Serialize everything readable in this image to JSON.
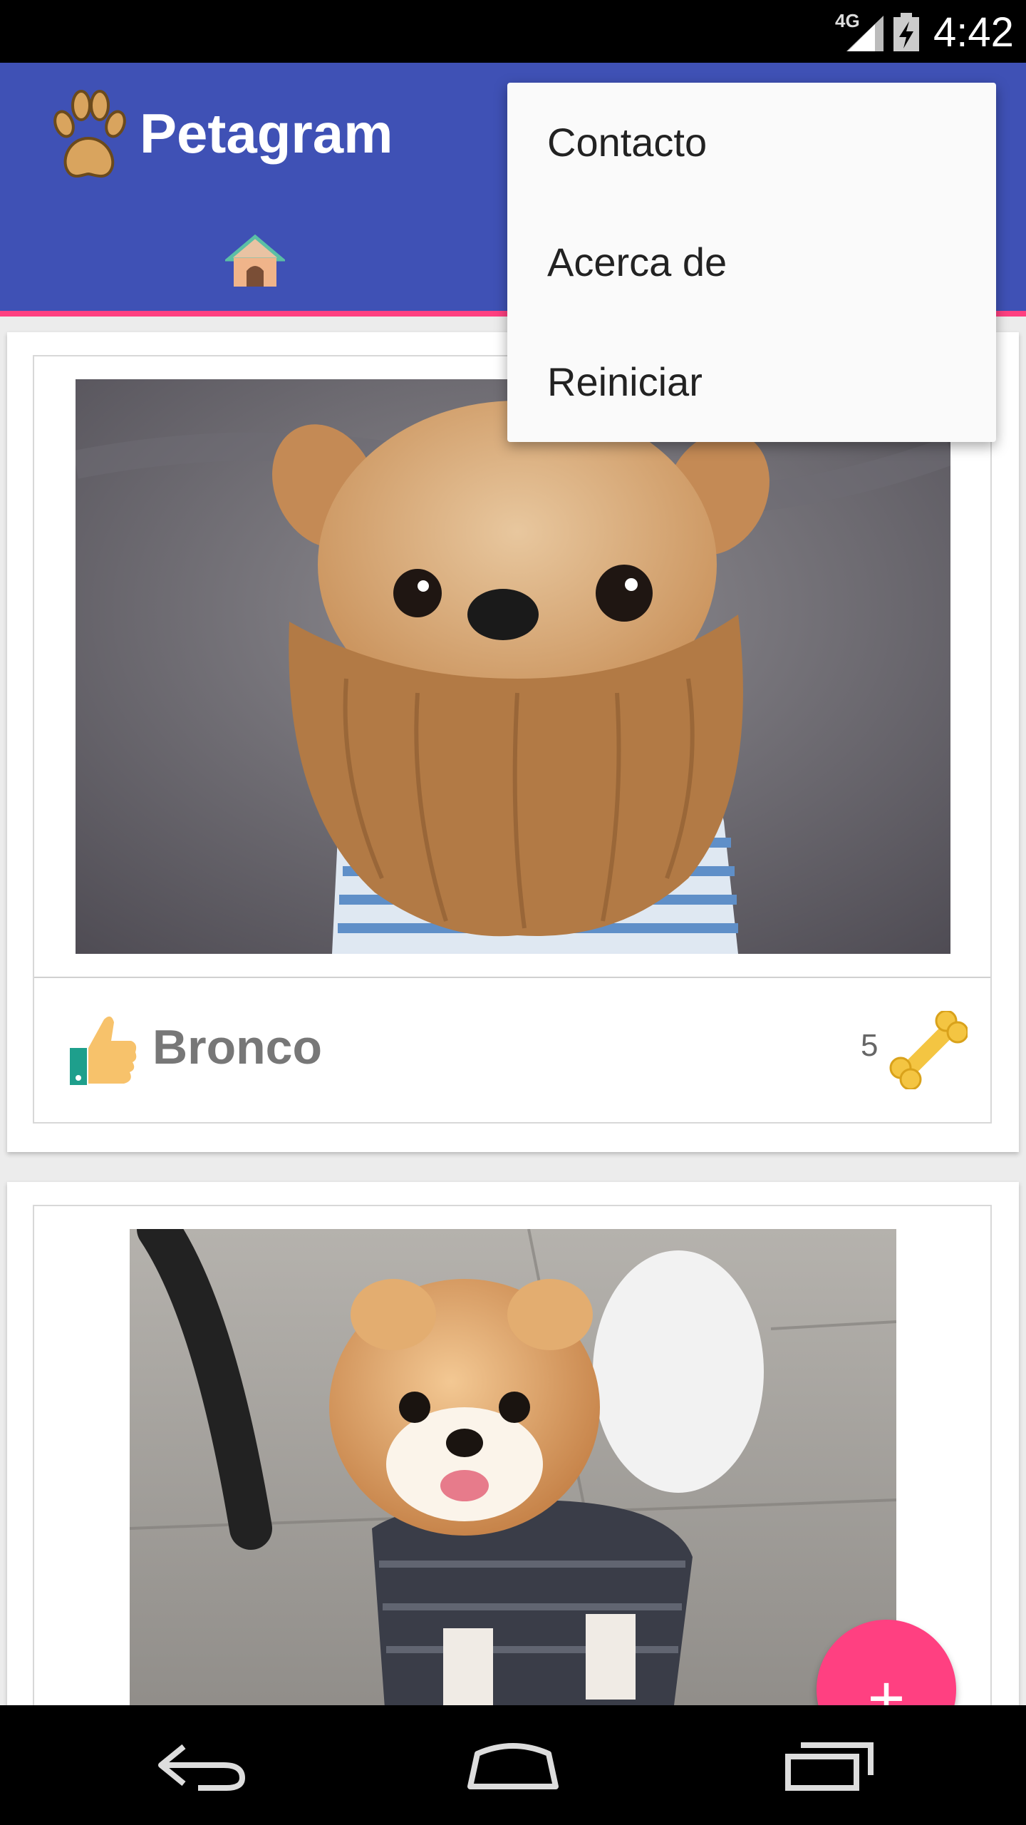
{
  "status_bar": {
    "network": "4G",
    "time": "4:42"
  },
  "app_bar": {
    "title": "Petagram"
  },
  "menu": {
    "items": [
      {
        "label": "Contacto"
      },
      {
        "label": "Acerca de"
      },
      {
        "label": "Reiniciar"
      }
    ]
  },
  "pets": [
    {
      "name": "Bronco",
      "likes": "5"
    }
  ],
  "fab": {
    "label": "+"
  },
  "colors": {
    "primary": "#3f51b5",
    "accent": "#ff4081"
  }
}
